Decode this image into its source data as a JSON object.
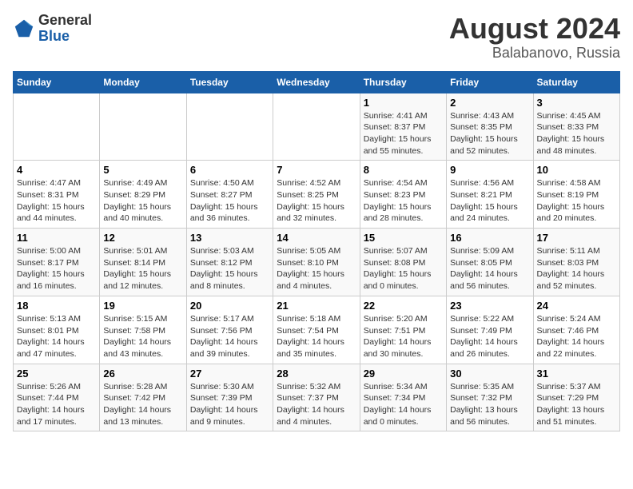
{
  "header": {
    "logo_general": "General",
    "logo_blue": "Blue",
    "main_title": "August 2024",
    "subtitle": "Balabanovo, Russia"
  },
  "calendar": {
    "headers": [
      "Sunday",
      "Monday",
      "Tuesday",
      "Wednesday",
      "Thursday",
      "Friday",
      "Saturday"
    ],
    "rows": [
      [
        {
          "day": "",
          "info": ""
        },
        {
          "day": "",
          "info": ""
        },
        {
          "day": "",
          "info": ""
        },
        {
          "day": "",
          "info": ""
        },
        {
          "day": "1",
          "info": "Sunrise: 4:41 AM\nSunset: 8:37 PM\nDaylight: 15 hours\nand 55 minutes."
        },
        {
          "day": "2",
          "info": "Sunrise: 4:43 AM\nSunset: 8:35 PM\nDaylight: 15 hours\nand 52 minutes."
        },
        {
          "day": "3",
          "info": "Sunrise: 4:45 AM\nSunset: 8:33 PM\nDaylight: 15 hours\nand 48 minutes."
        }
      ],
      [
        {
          "day": "4",
          "info": "Sunrise: 4:47 AM\nSunset: 8:31 PM\nDaylight: 15 hours\nand 44 minutes."
        },
        {
          "day": "5",
          "info": "Sunrise: 4:49 AM\nSunset: 8:29 PM\nDaylight: 15 hours\nand 40 minutes."
        },
        {
          "day": "6",
          "info": "Sunrise: 4:50 AM\nSunset: 8:27 PM\nDaylight: 15 hours\nand 36 minutes."
        },
        {
          "day": "7",
          "info": "Sunrise: 4:52 AM\nSunset: 8:25 PM\nDaylight: 15 hours\nand 32 minutes."
        },
        {
          "day": "8",
          "info": "Sunrise: 4:54 AM\nSunset: 8:23 PM\nDaylight: 15 hours\nand 28 minutes."
        },
        {
          "day": "9",
          "info": "Sunrise: 4:56 AM\nSunset: 8:21 PM\nDaylight: 15 hours\nand 24 minutes."
        },
        {
          "day": "10",
          "info": "Sunrise: 4:58 AM\nSunset: 8:19 PM\nDaylight: 15 hours\nand 20 minutes."
        }
      ],
      [
        {
          "day": "11",
          "info": "Sunrise: 5:00 AM\nSunset: 8:17 PM\nDaylight: 15 hours\nand 16 minutes."
        },
        {
          "day": "12",
          "info": "Sunrise: 5:01 AM\nSunset: 8:14 PM\nDaylight: 15 hours\nand 12 minutes."
        },
        {
          "day": "13",
          "info": "Sunrise: 5:03 AM\nSunset: 8:12 PM\nDaylight: 15 hours\nand 8 minutes."
        },
        {
          "day": "14",
          "info": "Sunrise: 5:05 AM\nSunset: 8:10 PM\nDaylight: 15 hours\nand 4 minutes."
        },
        {
          "day": "15",
          "info": "Sunrise: 5:07 AM\nSunset: 8:08 PM\nDaylight: 15 hours\nand 0 minutes."
        },
        {
          "day": "16",
          "info": "Sunrise: 5:09 AM\nSunset: 8:05 PM\nDaylight: 14 hours\nand 56 minutes."
        },
        {
          "day": "17",
          "info": "Sunrise: 5:11 AM\nSunset: 8:03 PM\nDaylight: 14 hours\nand 52 minutes."
        }
      ],
      [
        {
          "day": "18",
          "info": "Sunrise: 5:13 AM\nSunset: 8:01 PM\nDaylight: 14 hours\nand 47 minutes."
        },
        {
          "day": "19",
          "info": "Sunrise: 5:15 AM\nSunset: 7:58 PM\nDaylight: 14 hours\nand 43 minutes."
        },
        {
          "day": "20",
          "info": "Sunrise: 5:17 AM\nSunset: 7:56 PM\nDaylight: 14 hours\nand 39 minutes."
        },
        {
          "day": "21",
          "info": "Sunrise: 5:18 AM\nSunset: 7:54 PM\nDaylight: 14 hours\nand 35 minutes."
        },
        {
          "day": "22",
          "info": "Sunrise: 5:20 AM\nSunset: 7:51 PM\nDaylight: 14 hours\nand 30 minutes."
        },
        {
          "day": "23",
          "info": "Sunrise: 5:22 AM\nSunset: 7:49 PM\nDaylight: 14 hours\nand 26 minutes."
        },
        {
          "day": "24",
          "info": "Sunrise: 5:24 AM\nSunset: 7:46 PM\nDaylight: 14 hours\nand 22 minutes."
        }
      ],
      [
        {
          "day": "25",
          "info": "Sunrise: 5:26 AM\nSunset: 7:44 PM\nDaylight: 14 hours\nand 17 minutes."
        },
        {
          "day": "26",
          "info": "Sunrise: 5:28 AM\nSunset: 7:42 PM\nDaylight: 14 hours\nand 13 minutes."
        },
        {
          "day": "27",
          "info": "Sunrise: 5:30 AM\nSunset: 7:39 PM\nDaylight: 14 hours\nand 9 minutes."
        },
        {
          "day": "28",
          "info": "Sunrise: 5:32 AM\nSunset: 7:37 PM\nDaylight: 14 hours\nand 4 minutes."
        },
        {
          "day": "29",
          "info": "Sunrise: 5:34 AM\nSunset: 7:34 PM\nDaylight: 14 hours\nand 0 minutes."
        },
        {
          "day": "30",
          "info": "Sunrise: 5:35 AM\nSunset: 7:32 PM\nDaylight: 13 hours\nand 56 minutes."
        },
        {
          "day": "31",
          "info": "Sunrise: 5:37 AM\nSunset: 7:29 PM\nDaylight: 13 hours\nand 51 minutes."
        }
      ]
    ]
  }
}
